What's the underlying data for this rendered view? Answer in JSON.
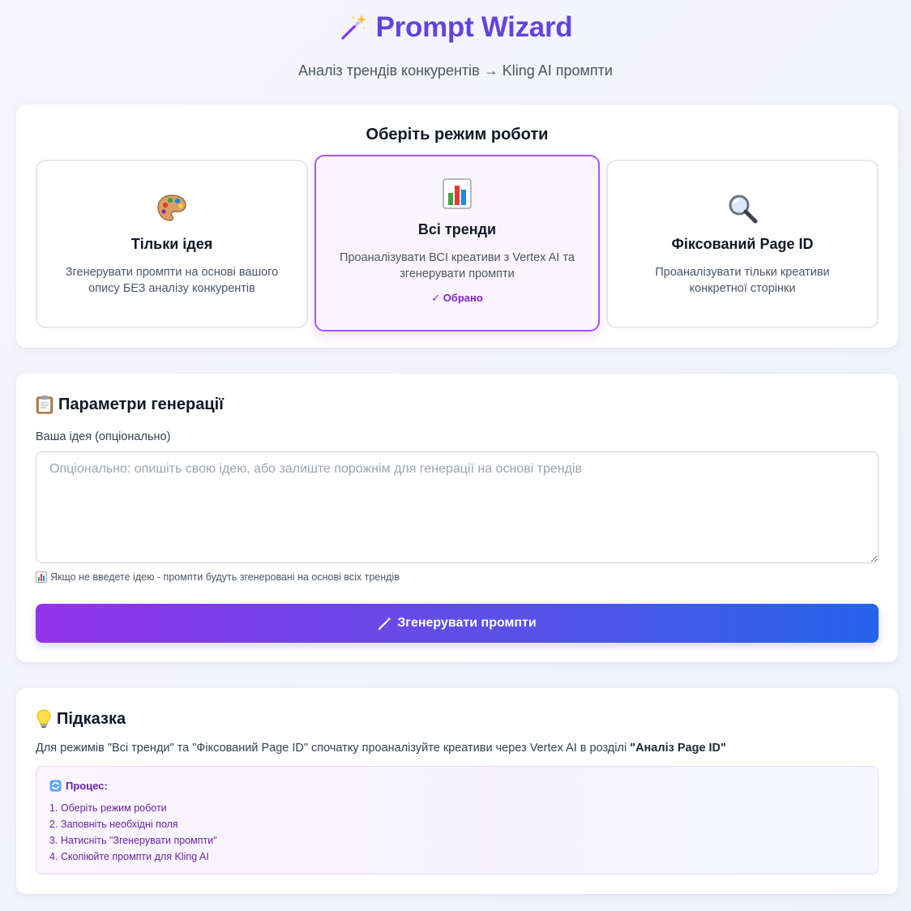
{
  "header": {
    "title": "Prompt Wizard",
    "subtitle": "Аналіз трендів конкурентів → Kling AI промпти"
  },
  "mode": {
    "heading": "Оберіть режим роботи",
    "options": [
      {
        "icon": "palette-icon",
        "emoji": "🎨",
        "title": "Тільки ідея",
        "desc": "Згенерувати промпти на основі вашого опису БЕЗ аналізу конкурентів",
        "selected": false
      },
      {
        "icon": "bar-chart-icon",
        "emoji": "📊",
        "title": "Всі тренди",
        "desc": "Проаналізувати ВСІ креативи з Vertex AI та згенерувати промпти",
        "selected": true,
        "selected_label": "✓ Обрано"
      },
      {
        "icon": "magnifier-icon",
        "emoji": "🔍",
        "title": "Фіксований Page ID",
        "desc": "Проаналізувати тільки креативи конкретної сторінки",
        "selected": false
      }
    ]
  },
  "params": {
    "title": "Параметри генерації",
    "title_emoji": "📋",
    "idea_label": "Ваша ідея (опціонально)",
    "idea_value": "",
    "idea_placeholder": "Опціонально: опишіть свою ідею, або залиште порожнім для генерації на основі трендів",
    "note_emoji": "📊",
    "note": "Якщо не введете ідею - промпти будуть згенеровані на основі всіх трендів",
    "generate_label": "Згенерувати промпти"
  },
  "hint": {
    "title_emoji": "💡",
    "title": "Підказка",
    "text": "Для режимів \"Всі тренди\" та \"Фіксований Page ID\" спочатку проаналізуйте креативи через Vertex AI в розділі ",
    "text_bold": "\"Аналіз Page ID\"",
    "process_emoji": "🔄",
    "process_title": "Процес:",
    "steps": [
      "1. Оберіть режим роботи",
      "2. Заповніть необхідні поля",
      "3. Натисніть \"Згенерувати промпти\"",
      "4. Скопіюйте промпти для Kling AI"
    ]
  },
  "colors": {
    "accent": "#6243e0",
    "selected_border": "#a855f7",
    "button_gradient_start": "#9333ea",
    "button_gradient_end": "#2563eb"
  }
}
